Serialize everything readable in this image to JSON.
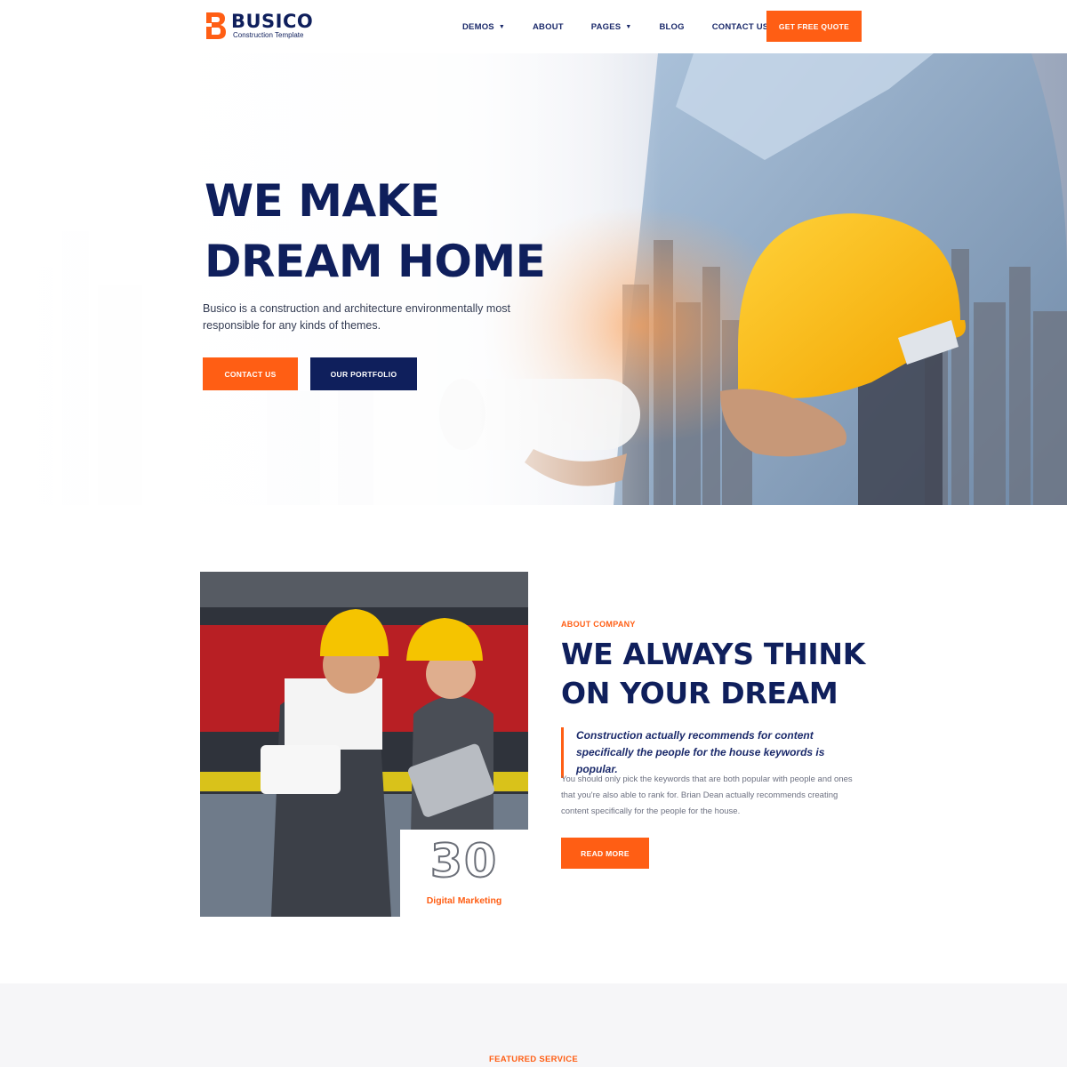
{
  "brand": {
    "name": "BUSICO",
    "tagline": "Construction Template",
    "accent": "#ff5e14",
    "navy": "#0f1f5c"
  },
  "nav": {
    "items": [
      {
        "label": "DEMOS",
        "dropdown": true
      },
      {
        "label": "ABOUT",
        "dropdown": false
      },
      {
        "label": "PAGES",
        "dropdown": true
      },
      {
        "label": "BLOG",
        "dropdown": false
      },
      {
        "label": "CONTACT US",
        "dropdown": false
      }
    ],
    "cta": "GET FREE QUOTE"
  },
  "hero": {
    "title_line1": "WE MAKE",
    "title_line2": "DREAM HOME",
    "description": "Busico is a construction and architecture environmentally most responsible for any kinds of themes.",
    "primary_button": "CONTACT US",
    "secondary_button": "OUR PORTFOLIO"
  },
  "about": {
    "kicker": "ABOUT COMPANY",
    "title_line1": "WE ALWAYS THINK",
    "title_line2": "ON YOUR DREAM",
    "quote": "Construction actually recommends for content specifically the people for the house keywords is popular.",
    "body": "You should only pick the keywords that are both popular with people and ones that you're also able to rank for. Brian Dean actually recommends creating content specifically for the people for the house.",
    "button": "READ MORE",
    "stat_number": "30",
    "stat_label": "Digital Marketing"
  },
  "featured": {
    "kicker": "FEATURED SERVICE"
  }
}
